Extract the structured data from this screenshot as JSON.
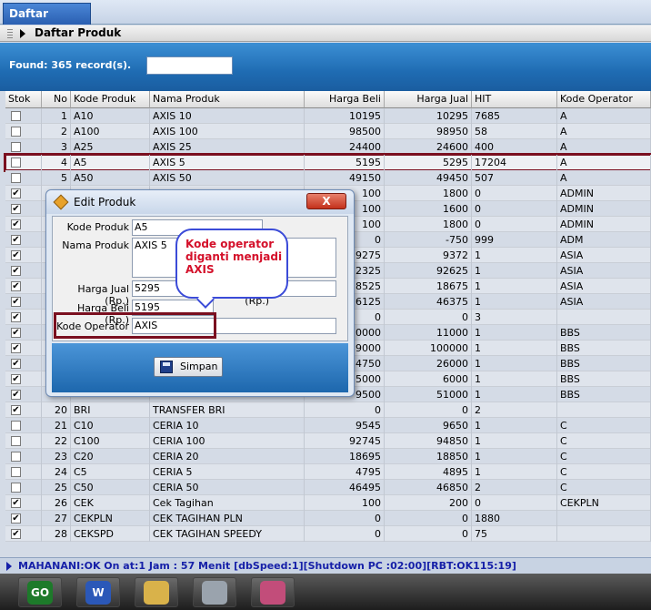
{
  "tab": {
    "label": "Daftar Produk"
  },
  "panel": {
    "title": "Daftar Produk"
  },
  "search": {
    "found_text": "Found:  365 record(s).",
    "value": ""
  },
  "columns": [
    "Stok",
    "No",
    "Kode Produk",
    "Nama Produk",
    "Harga Beli",
    "Harga Jual",
    "HIT",
    "Kode Operator"
  ],
  "rows": [
    {
      "stok": false,
      "no": "1",
      "kode": "A10",
      "nama": "AXIS 10",
      "beli": "10195",
      "jual": "10295",
      "hit": "7685",
      "op": "A"
    },
    {
      "stok": false,
      "no": "2",
      "kode": "A100",
      "nama": "AXIS 100",
      "beli": "98500",
      "jual": "98950",
      "hit": "58",
      "op": "A"
    },
    {
      "stok": false,
      "no": "3",
      "kode": "A25",
      "nama": "AXIS 25",
      "beli": "24400",
      "jual": "24600",
      "hit": "400",
      "op": "A"
    },
    {
      "stok": false,
      "no": "4",
      "kode": "A5",
      "nama": "AXIS 5",
      "beli": "5195",
      "jual": "5295",
      "hit": "17204",
      "op": "A"
    },
    {
      "stok": false,
      "no": "5",
      "kode": "A50",
      "nama": "AXIS 50",
      "beli": "49150",
      "jual": "49450",
      "hit": "507",
      "op": "A"
    },
    {
      "stok": true,
      "no": "",
      "kode": "",
      "nama": "",
      "beli": "100",
      "jual": "1800",
      "hit": "0",
      "op": "ADMIN"
    },
    {
      "stok": true,
      "no": "",
      "kode": "",
      "nama": "",
      "beli": "100",
      "jual": "1600",
      "hit": "0",
      "op": "ADMIN"
    },
    {
      "stok": true,
      "no": "",
      "kode": "",
      "nama": "",
      "beli": "100",
      "jual": "1800",
      "hit": "0",
      "op": "ADMIN"
    },
    {
      "stok": true,
      "no": "",
      "kode": "",
      "nama": "",
      "beli": "0",
      "jual": "-750",
      "hit": "999",
      "op": "ADM"
    },
    {
      "stok": true,
      "no": "",
      "kode": "",
      "nama": "",
      "beli": "9275",
      "jual": "9372",
      "hit": "1",
      "op": "ASIA"
    },
    {
      "stok": true,
      "no": "",
      "kode": "",
      "nama": "",
      "beli": "2325",
      "jual": "92625",
      "hit": "1",
      "op": "ASIA"
    },
    {
      "stok": true,
      "no": "",
      "kode": "",
      "nama": "",
      "beli": "8525",
      "jual": "18675",
      "hit": "1",
      "op": "ASIA"
    },
    {
      "stok": true,
      "no": "",
      "kode": "",
      "nama": "",
      "beli": "6125",
      "jual": "46375",
      "hit": "1",
      "op": "ASIA"
    },
    {
      "stok": true,
      "no": "",
      "kode": "",
      "nama": "",
      "beli": "0",
      "jual": "0",
      "hit": "3",
      "op": ""
    },
    {
      "stok": true,
      "no": "",
      "kode": "",
      "nama": "",
      "beli": "0000",
      "jual": "11000",
      "hit": "1",
      "op": "BBS"
    },
    {
      "stok": true,
      "no": "",
      "kode": "",
      "nama": "",
      "beli": "9000",
      "jual": "100000",
      "hit": "1",
      "op": "BBS"
    },
    {
      "stok": true,
      "no": "",
      "kode": "",
      "nama": "",
      "beli": "4750",
      "jual": "26000",
      "hit": "1",
      "op": "BBS"
    },
    {
      "stok": true,
      "no": "",
      "kode": "",
      "nama": "",
      "beli": "5000",
      "jual": "6000",
      "hit": "1",
      "op": "BBS"
    },
    {
      "stok": true,
      "no": "",
      "kode": "",
      "nama": "",
      "beli": "9500",
      "jual": "51000",
      "hit": "1",
      "op": "BBS"
    },
    {
      "stok": true,
      "no": "20",
      "kode": "BRI",
      "nama": "TRANSFER BRI",
      "beli": "0",
      "jual": "0",
      "hit": "2",
      "op": ""
    },
    {
      "stok": false,
      "no": "21",
      "kode": "C10",
      "nama": "CERIA 10",
      "beli": "9545",
      "jual": "9650",
      "hit": "1",
      "op": "C"
    },
    {
      "stok": false,
      "no": "22",
      "kode": "C100",
      "nama": "CERIA 100",
      "beli": "92745",
      "jual": "94850",
      "hit": "1",
      "op": "C"
    },
    {
      "stok": false,
      "no": "23",
      "kode": "C20",
      "nama": "CERIA 20",
      "beli": "18695",
      "jual": "18850",
      "hit": "1",
      "op": "C"
    },
    {
      "stok": false,
      "no": "24",
      "kode": "C5",
      "nama": "CERIA 5",
      "beli": "4795",
      "jual": "4895",
      "hit": "1",
      "op": "C"
    },
    {
      "stok": false,
      "no": "25",
      "kode": "C50",
      "nama": "CERIA 50",
      "beli": "46495",
      "jual": "46850",
      "hit": "2",
      "op": "C"
    },
    {
      "stok": true,
      "no": "26",
      "kode": "CEK",
      "nama": "Cek Tagihan",
      "beli": "100",
      "jual": "200",
      "hit": "0",
      "op": "CEKPLN"
    },
    {
      "stok": true,
      "no": "27",
      "kode": "CEKPLN",
      "nama": "CEK TAGIHAN PLN",
      "beli": "0",
      "jual": "0",
      "hit": "1880",
      "op": ""
    },
    {
      "stok": true,
      "no": "28",
      "kode": "CEKSPD",
      "nama": "CEK TAGIHAN SPEEDY",
      "beli": "0",
      "jual": "0",
      "hit": "75",
      "op": ""
    }
  ],
  "dialog": {
    "title": "Edit Produk",
    "close_label": "X",
    "kode_label": "Kode Produk",
    "kode_value": "A5",
    "nama_label": "Nama Produk",
    "nama_value": "AXIS 5",
    "jual_label": "Harga Jual (Rp.)",
    "jual_value": "5295",
    "selisih_label": "Selisih (Rp.)",
    "selisih_value": "",
    "beli_label": "Harga Beli (Rp.)",
    "beli_value": "5195",
    "op_label": "Kode Operator",
    "op_value": "AXIS",
    "save_label": "Simpan"
  },
  "callout": {
    "text": "Kode operator diganti menjadi AXIS"
  },
  "status": {
    "text": "MAHANANI:OK On at:1 Jam : 57 Menit [dbSpeed:1][Shutdown PC :02:00][RBT:OK115:19]"
  },
  "taskbar": [
    {
      "name": "go-app-icon",
      "label": "GO"
    },
    {
      "name": "word-app-icon",
      "label": "W"
    },
    {
      "name": "file-manager-icon",
      "label": ""
    },
    {
      "name": "calculator-icon",
      "label": ""
    },
    {
      "name": "messenger-icon",
      "label": ""
    }
  ],
  "colors": {
    "accent_blue": "#1f6cb3",
    "highlight_red": "#7a0f1f",
    "callout_text": "#d4102a"
  }
}
